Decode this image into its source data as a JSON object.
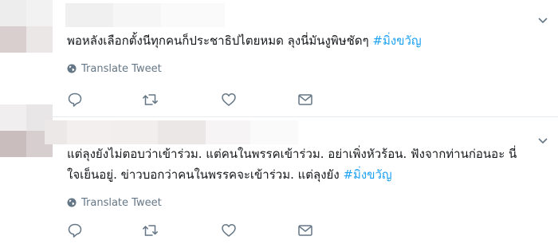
{
  "tweets": [
    {
      "text": "พอหลังเลือกตั้งนีทุกคนก็ประชาธิปไตยหมด ลุงนี่มันงูพิษชัดๆ",
      "hashtag": "#มิ่งขวัญ",
      "translate_label": "Translate Tweet"
    },
    {
      "text_line1": "แต่ลุงยังไม่ตอบว่าเข้าร่วม. แต่คนในพรรคเข้าร่วม. อย่าเพิ่งหัวร้อน. ฟังจากท่านก่อนอะ นี่",
      "text_line2": "ใจเย็นอยู่. ข่าวบอกว่าคนในพรรคจะเข้าร่วม. แต่ลุงยัง",
      "hashtag": "#มิ่งขวัญ",
      "translate_label": "Translate Tweet"
    }
  ],
  "icons": {
    "translate": "globe-icon",
    "reply": "reply-icon",
    "retweet": "retweet-icon",
    "like": "heart-icon",
    "message": "envelope-icon",
    "more": "chevron-down-icon"
  },
  "colors": {
    "hashtag": "#1da1f2",
    "muted": "#657786",
    "divider": "#e6ecf0"
  }
}
